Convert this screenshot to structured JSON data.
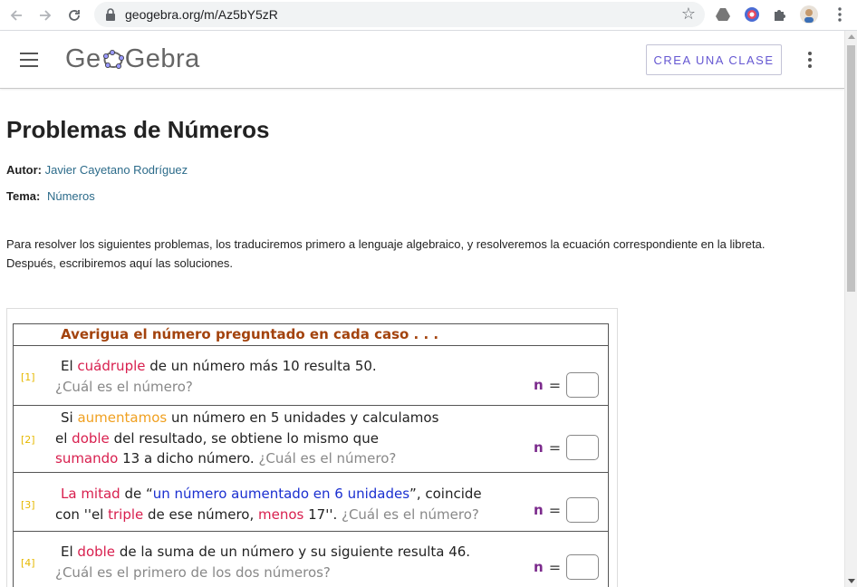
{
  "browser": {
    "url": "geogebra.org/m/Az5bY5zR"
  },
  "header": {
    "logo_left": "Ge",
    "logo_right": "Gebra",
    "cta_label": "CREA UNA CLASE"
  },
  "page": {
    "title": "Problemas de Números",
    "author_label": "Autor:",
    "author_name": "Javier Cayetano Rodríguez",
    "topic_label": "Tema:",
    "topic_name": "Números",
    "description_line1": "Para resolver los siguientes problemas, los traduciremos primero a lenguaje algebraico, y resolveremos la ecuación correspondiente en la libreta.",
    "description_line2": "Después, escribiremos aquí las soluciones."
  },
  "applet": {
    "heading": "Averigua el número preguntado en cada caso . . .",
    "variable": "n",
    "equals": "=",
    "problems": [
      {
        "number": "[1]",
        "l1a": "El ",
        "l1b": "cuádruple",
        "l1c": " de un número más 10 resulta 50.",
        "l2": "¿Cuál es el número?"
      },
      {
        "number": "[2]",
        "l1a": "Si ",
        "l1b": "aumentamos",
        "l1c": " un número en 5 unidades y calculamos",
        "l2a": "el ",
        "l2b": "doble",
        "l2c": " del resultado, se obtiene lo mismo que",
        "l3a": "sumando",
        "l3b": " 13 a dicho número. ",
        "l3c": "¿Cuál es el número?"
      },
      {
        "number": "[3]",
        "l1a": "La mitad",
        "l1b": " de “",
        "l1c": "un número aumentado en 6 unidades",
        "l1d": "”, coincide",
        "l2a": "con ''el ",
        "l2b": "triple",
        "l2c": " de ese número, ",
        "l2d": "menos",
        "l2e": " 17''. ",
        "l2f": "¿Cuál es el número?"
      },
      {
        "number": "[4]",
        "l1a": "El ",
        "l1b": "doble",
        "l1c": " de la suma de un número y su siguiente resulta 46.",
        "l2": "¿Cuál es el primero de los dos números?"
      }
    ]
  }
}
